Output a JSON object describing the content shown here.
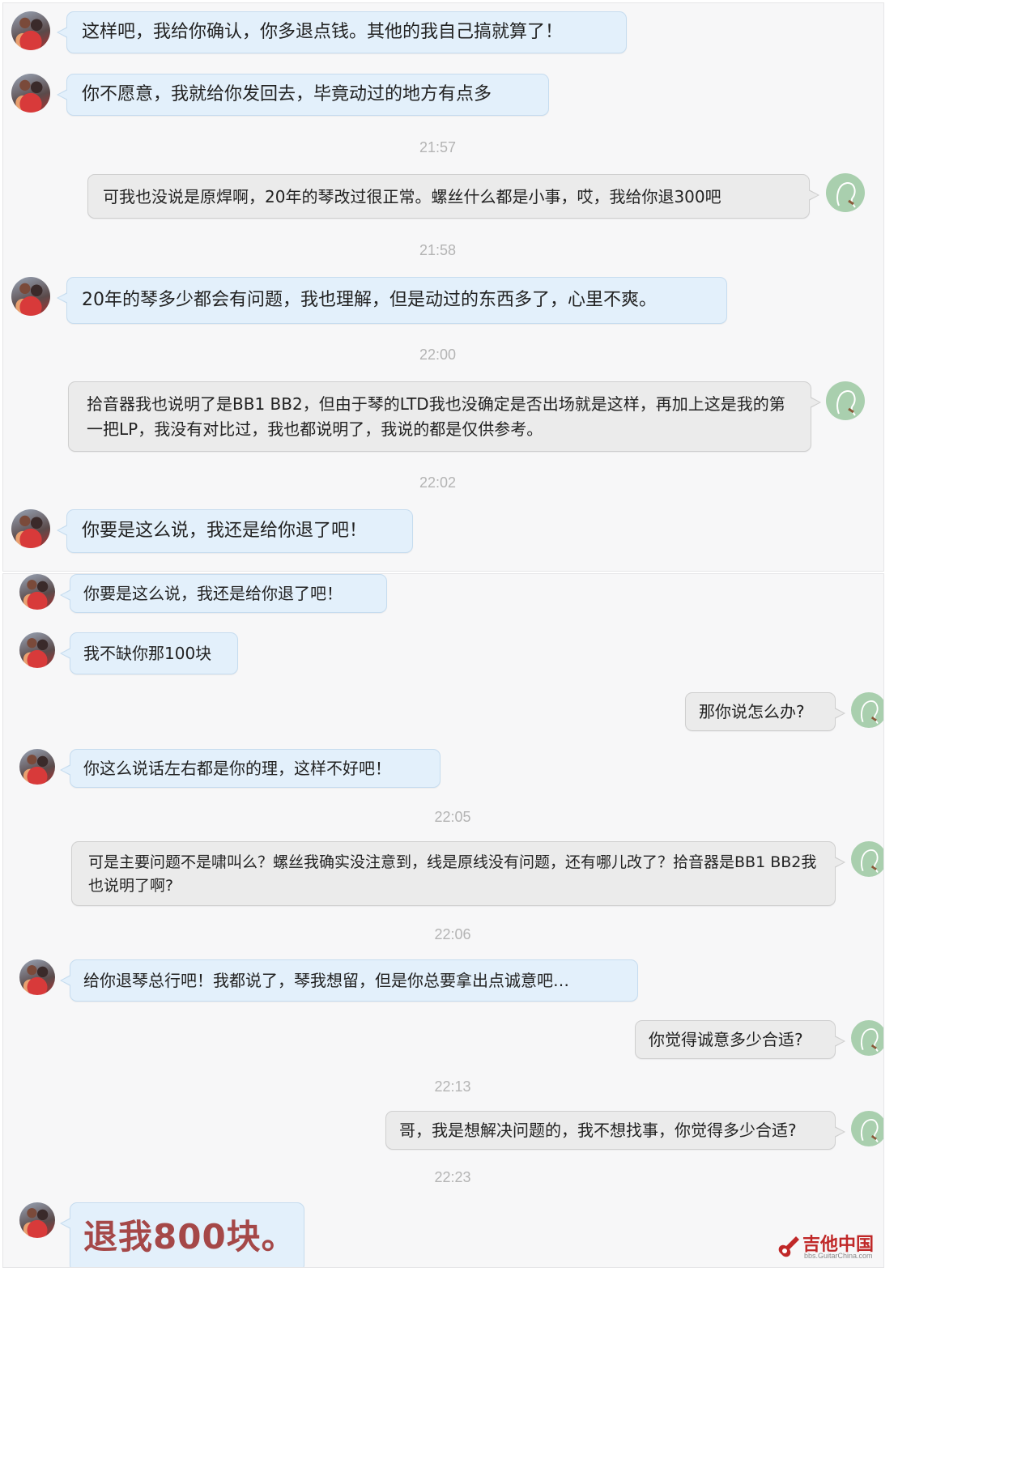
{
  "panel_1": {
    "messages": [
      {
        "text": "这样吧，我给你确认，你多退点钱。其他的我自己搞就算了！"
      },
      {
        "text": "你不愿意，我就给你发回去，毕竟动过的地方有点多"
      },
      {
        "time": "21:57"
      },
      {
        "text": "可我也没说是原焊啊，20年的琴改过很正常。螺丝什么都是小事，哎，我给你退300吧"
      },
      {
        "time": "21:58"
      },
      {
        "text": "20年的琴多少都会有问题，我也理解，但是动过的东西多了，心里不爽。"
      },
      {
        "time": "22:00"
      },
      {
        "text": "拾音器我也说明了是BB1 BB2，但由于琴的LTD我也没确定是否出场就是这样，再加上这是我的第一把LP，我没有对比过，我也都说明了，我说的都是仅供参考。"
      },
      {
        "time": "22:02"
      },
      {
        "text": "你要是这么说，我还是给你退了吧！"
      }
    ]
  },
  "panel_2": {
    "messages": [
      {
        "text": "你要是这么说，我还是给你退了吧！"
      },
      {
        "text": "我不缺你那100块"
      },
      {
        "text": "那你说怎么办?"
      },
      {
        "text": "你这么说话左右都是你的理，这样不好吧！"
      },
      {
        "time": "22:05"
      },
      {
        "text": "可是主要问题不是啸叫么？螺丝我确实没注意到，线是原线没有问题，还有哪儿改了？拾音器是BB1 BB2我也说明了啊?"
      },
      {
        "time": "22:06"
      },
      {
        "text": "给你退琴总行吧！我都说了，琴我想留，但是你总要拿出点诚意吧…"
      },
      {
        "text": "你觉得诚意多少合适?"
      },
      {
        "time": "22:13"
      },
      {
        "text": "哥，我是想解决问题的，我不想找事，你觉得多少合适?"
      },
      {
        "time": "22:23"
      },
      {
        "text": "退我800块。"
      }
    ]
  },
  "watermark": {
    "title": "吉他中国",
    "url": "bbs.GuitarChina.com",
    "icon": "guitar-logo-icon"
  },
  "colors": {
    "incoming_bubble": "#e3f0fb",
    "outgoing_bubble": "#ebebeb",
    "timestamp": "#b4b4b4",
    "emphasis_text": "#a54848",
    "watermark": "#c02828"
  }
}
